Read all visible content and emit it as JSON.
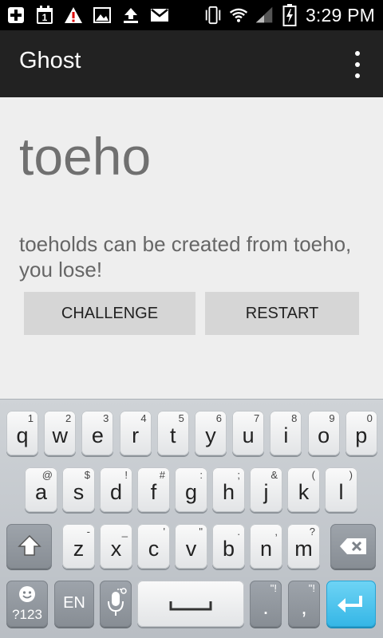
{
  "status_bar": {
    "icons": [
      "plus-icon",
      "calendar-icon",
      "warning-icon",
      "image-icon",
      "upload-icon",
      "gmail-icon",
      "vibrate-icon",
      "wifi-icon",
      "signal-icon",
      "battery-charging-icon"
    ],
    "calendar_day": "1",
    "time": "3:29 PM"
  },
  "action_bar": {
    "title": "Ghost",
    "overflow_icon": "overflow-menu-icon"
  },
  "game": {
    "word": "toeho",
    "message": "toeholds can be created from toeho, you lose!",
    "challenge_label": "CHALLENGE",
    "restart_label": "RESTART"
  },
  "keyboard": {
    "row1": [
      {
        "key": "q",
        "hint": "1"
      },
      {
        "key": "w",
        "hint": "2"
      },
      {
        "key": "e",
        "hint": "3"
      },
      {
        "key": "r",
        "hint": "4"
      },
      {
        "key": "t",
        "hint": "5"
      },
      {
        "key": "y",
        "hint": "6"
      },
      {
        "key": "u",
        "hint": "7"
      },
      {
        "key": "i",
        "hint": "8"
      },
      {
        "key": "o",
        "hint": "9"
      },
      {
        "key": "p",
        "hint": "0"
      }
    ],
    "row2": [
      {
        "key": "a",
        "hint": "@"
      },
      {
        "key": "s",
        "hint": "$"
      },
      {
        "key": "d",
        "hint": "!"
      },
      {
        "key": "f",
        "hint": "#"
      },
      {
        "key": "g",
        "hint": ":"
      },
      {
        "key": "h",
        "hint": ";"
      },
      {
        "key": "j",
        "hint": "&"
      },
      {
        "key": "k",
        "hint": "("
      },
      {
        "key": "l",
        "hint": ")"
      }
    ],
    "row3": [
      {
        "key": "z",
        "hint": "-"
      },
      {
        "key": "x",
        "hint": "_"
      },
      {
        "key": "c",
        "hint": "'"
      },
      {
        "key": "v",
        "hint": "\""
      },
      {
        "key": "b",
        "hint": "."
      },
      {
        "key": "n",
        "hint": ","
      },
      {
        "key": "m",
        "hint": "?"
      }
    ],
    "symbols_label": "?123",
    "lang_label": "EN",
    "period_key": ".",
    "period_hint": "\"!",
    "comma_key": ",",
    "comma_hint": "\"!",
    "shift_icon": "shift-icon",
    "backspace_icon": "backspace-icon",
    "emoji_icon": "emoji-icon",
    "mic_icon": "microphone-icon",
    "space_icon": "space-icon",
    "enter_icon": "enter-icon"
  },
  "colors": {
    "status_bar_bg": "#000000",
    "action_bar_bg": "#222222",
    "content_bg": "#eeeeee",
    "button_bg": "#d6d6d6",
    "enter_key": "#35b6e6"
  }
}
